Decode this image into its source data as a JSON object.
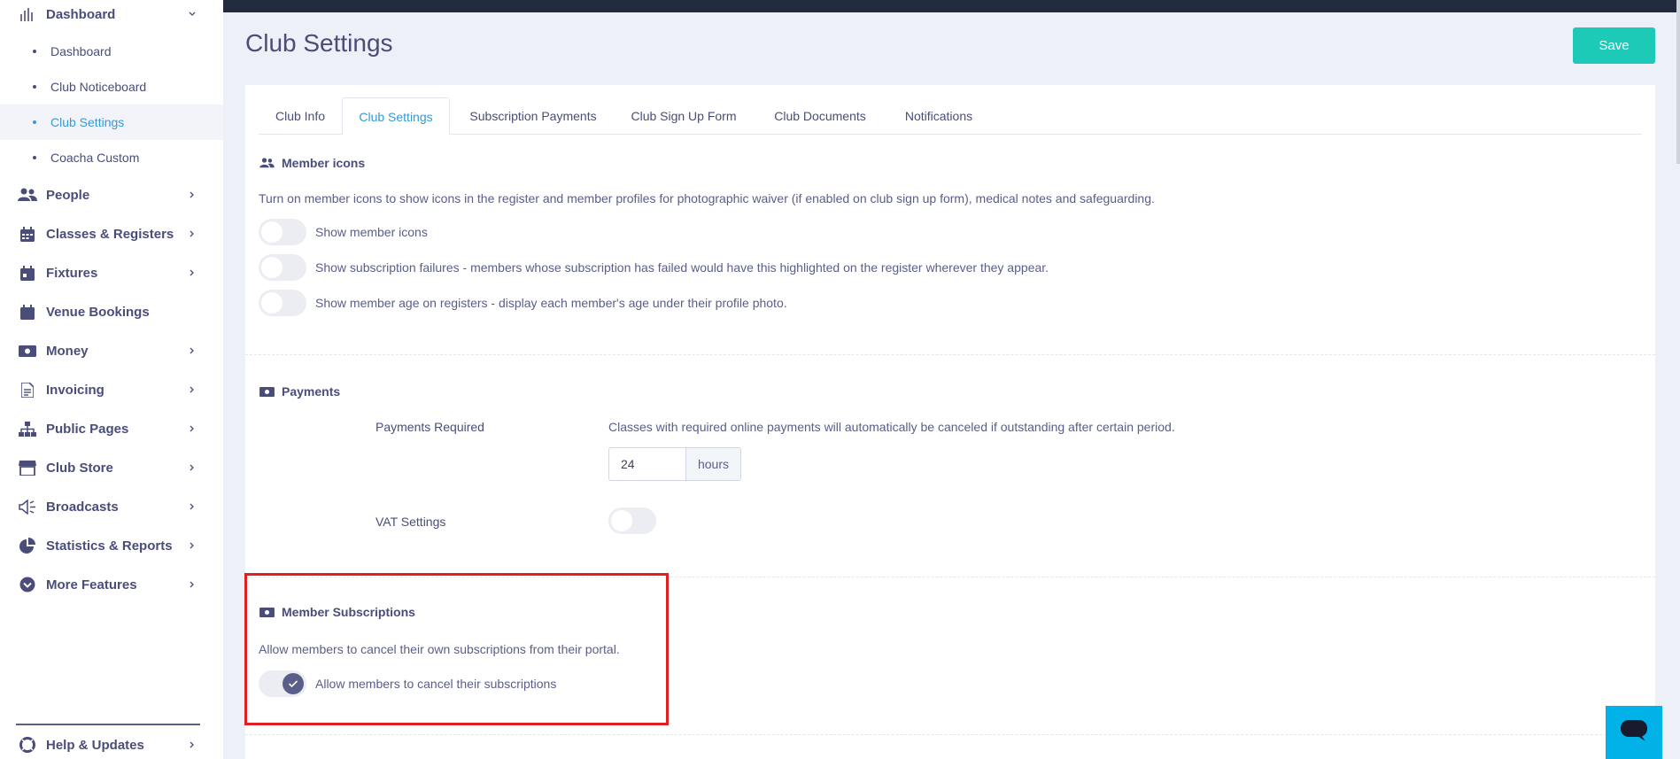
{
  "sidebar": {
    "dashboard_group": {
      "label": "Dashboard",
      "icon": "bar-chart-icon"
    },
    "sub_items": [
      {
        "label": "Dashboard",
        "active": false
      },
      {
        "label": "Club Noticeboard",
        "active": false
      },
      {
        "label": "Club Settings",
        "active": true
      },
      {
        "label": "Coacha Custom",
        "active": false
      }
    ],
    "items": [
      {
        "label": "People",
        "icon": "people-icon"
      },
      {
        "label": "Classes & Registers",
        "icon": "calendar-icon"
      },
      {
        "label": "Fixtures",
        "icon": "calendar-icon"
      },
      {
        "label": "Venue Bookings",
        "icon": "calendar-icon"
      },
      {
        "label": "Money",
        "icon": "money-icon"
      },
      {
        "label": "Invoicing",
        "icon": "document-icon"
      },
      {
        "label": "Public Pages",
        "icon": "sitemap-icon"
      },
      {
        "label": "Club Store",
        "icon": "store-icon"
      },
      {
        "label": "Broadcasts",
        "icon": "megaphone-icon"
      },
      {
        "label": "Statistics & Reports",
        "icon": "pie-chart-icon"
      },
      {
        "label": "More Features",
        "icon": "chevron-circle-icon"
      }
    ],
    "help": {
      "label": "Help & Updates",
      "icon": "lifebuoy-icon"
    }
  },
  "header": {
    "title": "Club Settings",
    "save_label": "Save"
  },
  "tabs": [
    {
      "label": "Club Info",
      "active": false
    },
    {
      "label": "Club Settings",
      "active": true
    },
    {
      "label": "Subscription Payments",
      "active": false
    },
    {
      "label": "Club Sign Up Form",
      "active": false
    },
    {
      "label": "Club Documents",
      "active": false
    },
    {
      "label": "Notifications",
      "active": false
    }
  ],
  "member_icons": {
    "title": "Member icons",
    "description": "Turn on member icons to show icons in the register and member profiles for photographic waiver (if enabled on club sign up form), medical notes and safeguarding.",
    "toggles": [
      {
        "label": "Show member icons",
        "on": false
      },
      {
        "label": "Show subscription failures - members whose subscription has failed would have this highlighted on the register wherever they appear.",
        "on": false
      },
      {
        "label": "Show member age on registers - display each member's age under their profile photo.",
        "on": false
      }
    ]
  },
  "payments": {
    "title": "Payments",
    "payments_required_label": "Payments Required",
    "payments_required_desc": "Classes with required online payments will automatically be canceled if outstanding after certain period.",
    "hours_value": "24",
    "hours_unit": "hours",
    "vat_label": "VAT Settings",
    "vat_on": false
  },
  "member_subscriptions": {
    "title": "Member Subscriptions",
    "description": "Allow members to cancel their own subscriptions from their portal.",
    "toggle_label": "Allow members to cancel their subscriptions",
    "toggle_on": true
  },
  "colors": {
    "accent": "#3699d6",
    "save": "#1dc9b7",
    "highlight": "#e02020",
    "chat": "#00b2e8",
    "topbar": "#222b3d"
  }
}
